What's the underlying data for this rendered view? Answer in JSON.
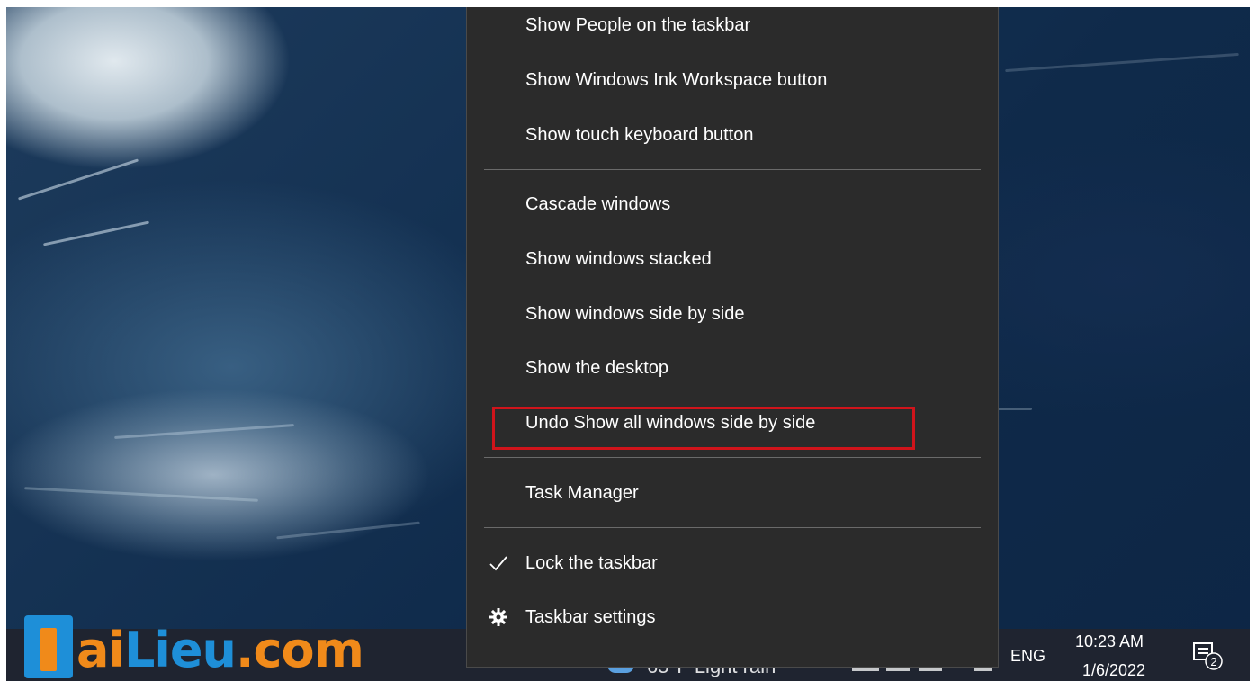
{
  "desktop": {
    "accent_color": "#0f2a4a"
  },
  "context_menu": {
    "items": [
      {
        "label": "Show People on the taskbar"
      },
      {
        "label": "Show Windows Ink Workspace button"
      },
      {
        "label": "Show touch keyboard button"
      },
      {
        "label": "Cascade windows"
      },
      {
        "label": "Show windows stacked"
      },
      {
        "label": "Show windows side by side"
      },
      {
        "label": "Show the desktop"
      },
      {
        "label": "Undo Show all windows side by side",
        "highlighted": true,
        "highlight_color": "#d0141b"
      },
      {
        "label": "Task Manager"
      },
      {
        "label": "Lock the taskbar",
        "icon": "checkmark-icon",
        "checked": true
      },
      {
        "label": "Taskbar settings",
        "icon": "gear-icon"
      }
    ]
  },
  "taskbar": {
    "weather_text": "65°F  Light rain",
    "language": "ENG",
    "time": "10:23 AM",
    "date": "1/6/2022",
    "notification_count": "2"
  },
  "watermark": {
    "part1": "ai",
    "part2": "Lieu",
    "part3": ".com"
  }
}
